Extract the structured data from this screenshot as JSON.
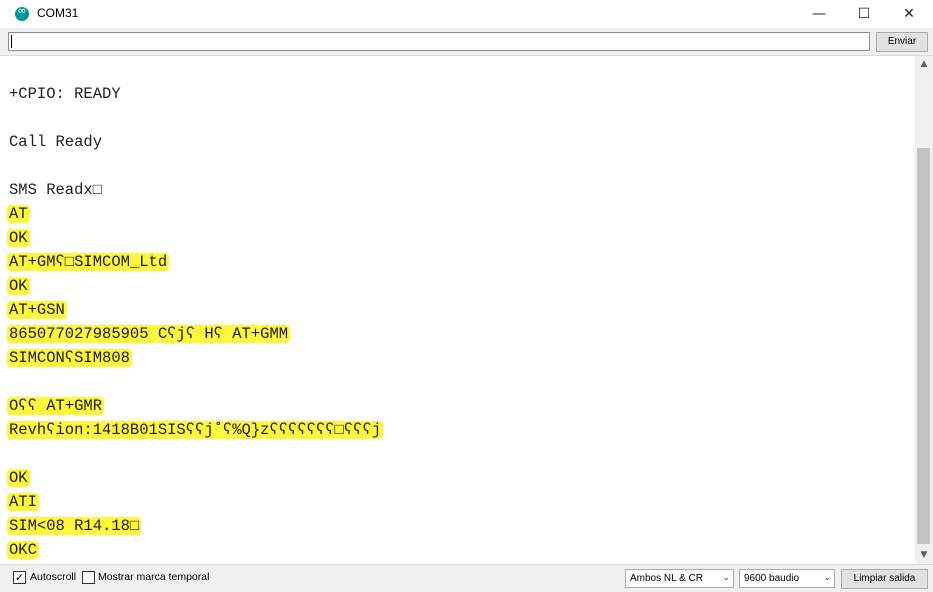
{
  "window": {
    "title": "COM31",
    "minimize_glyph": "—",
    "maximize_glyph": "☐",
    "close_glyph": "✕"
  },
  "toolbar": {
    "input_value": "",
    "send_label": "Enviar"
  },
  "output_lines": [
    "+CPIO: READY",
    "Call Ready",
    "SMS Readx□",
    "AT",
    "OK",
    "AT+GMʕ□SIMCOM_Ltd",
    "OK",
    "AT+GSN",
    "865077027985905 Cʕjʕ Hʕ AT+GMM",
    "SIMCONʕSIM808",
    "Oʕʕ AT+GMR",
    "Revhʕion:1418B01SISʕʕj˚ʕ%Q}zʕʕʕʕʕʕʕ□ʕʕʕj",
    "OK",
    "ATI",
    "SIM<08 R14.18□",
    "OKC"
  ],
  "scrollbar": {
    "up_glyph": "▲",
    "down_glyph": "▼"
  },
  "statusbar": {
    "autoscroll_label": "Autoscroll",
    "autoscroll_checked": true,
    "timestamp_label": "Mostrar marca temporal",
    "timestamp_checked": false,
    "line_ending": "Ambos NL & CR",
    "baud_rate": "9600 baudio",
    "clear_label": "Limpiar salida"
  },
  "colors": {
    "highlight": "#fff53b",
    "arduino_teal": "#00979c"
  }
}
